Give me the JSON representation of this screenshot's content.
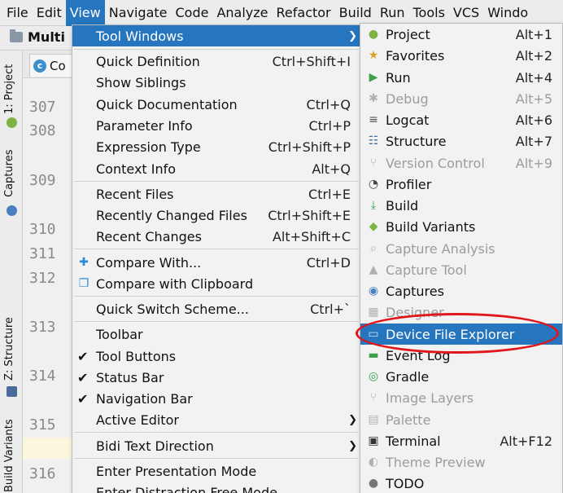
{
  "menubar": {
    "items": [
      "File",
      "Edit",
      "View",
      "Navigate",
      "Code",
      "Analyze",
      "Refactor",
      "Build",
      "Run",
      "Tools",
      "VCS",
      "Windo"
    ]
  },
  "ide": {
    "project_name": "Multi",
    "tab_label": "Co",
    "side_labels": [
      "1: Project",
      "Captures",
      "Z: Structure",
      "Build Variants"
    ],
    "line_numbers": [
      "307",
      "308",
      "309",
      "310",
      "311",
      "312",
      "313",
      "314",
      "315",
      "316"
    ]
  },
  "view_menu": {
    "items": [
      {
        "label": "Tool Windows",
        "shortcut": "",
        "submenu": true
      },
      {
        "label": "Quick Definition",
        "shortcut": "Ctrl+Shift+I"
      },
      {
        "label": "Show Siblings",
        "shortcut": ""
      },
      {
        "label": "Quick Documentation",
        "shortcut": "Ctrl+Q"
      },
      {
        "label": "Parameter Info",
        "shortcut": "Ctrl+P"
      },
      {
        "label": "Expression Type",
        "shortcut": "Ctrl+Shift+P"
      },
      {
        "label": "Context Info",
        "shortcut": "Alt+Q"
      },
      {
        "label": "Recent Files",
        "shortcut": "Ctrl+E"
      },
      {
        "label": "Recently Changed Files",
        "shortcut": "Ctrl+Shift+E"
      },
      {
        "label": "Recent Changes",
        "shortcut": "Alt+Shift+C"
      },
      {
        "label": "Compare With...",
        "shortcut": "Ctrl+D"
      },
      {
        "label": "Compare with Clipboard",
        "shortcut": ""
      },
      {
        "label": "Quick Switch Scheme...",
        "shortcut": "Ctrl+`"
      },
      {
        "label": "Toolbar",
        "shortcut": ""
      },
      {
        "label": "Tool Buttons",
        "shortcut": ""
      },
      {
        "label": "Status Bar",
        "shortcut": ""
      },
      {
        "label": "Navigation Bar",
        "shortcut": ""
      },
      {
        "label": "Active Editor",
        "shortcut": ""
      },
      {
        "label": "Bidi Text Direction",
        "shortcut": ""
      },
      {
        "label": "Enter Presentation Mode",
        "shortcut": ""
      },
      {
        "label": "Enter Distraction Free Mode",
        "shortcut": ""
      }
    ]
  },
  "tool_windows_menu": {
    "items": [
      {
        "label": "Project",
        "shortcut": "Alt+1",
        "icon": "android-project-icon"
      },
      {
        "label": "Favorites",
        "shortcut": "Alt+2",
        "icon": "star-icon"
      },
      {
        "label": "Run",
        "shortcut": "Alt+4",
        "icon": "play-icon"
      },
      {
        "label": "Debug",
        "shortcut": "Alt+5",
        "icon": "bug-icon"
      },
      {
        "label": "Logcat",
        "shortcut": "Alt+6",
        "icon": "logcat-icon"
      },
      {
        "label": "Structure",
        "shortcut": "Alt+7",
        "icon": "structure-icon"
      },
      {
        "label": "Version Control",
        "shortcut": "Alt+9",
        "icon": "vcs-icon"
      },
      {
        "label": "Profiler",
        "shortcut": "",
        "icon": "gauge-icon"
      },
      {
        "label": "Build",
        "shortcut": "",
        "icon": "build-icon"
      },
      {
        "label": "Build Variants",
        "shortcut": "",
        "icon": "android-icon"
      },
      {
        "label": "Capture Analysis",
        "shortcut": "",
        "icon": "magnifier-icon"
      },
      {
        "label": "Capture Tool",
        "shortcut": "",
        "icon": "capture-tool-icon"
      },
      {
        "label": "Captures",
        "shortcut": "",
        "icon": "camera-icon"
      },
      {
        "label": "Designer",
        "shortcut": "",
        "icon": "designer-icon"
      },
      {
        "label": "Device File Explorer",
        "shortcut": "",
        "icon": "device-file-icon"
      },
      {
        "label": "Event Log",
        "shortcut": "",
        "icon": "event-log-icon"
      },
      {
        "label": "Gradle",
        "shortcut": "",
        "icon": "gradle-icon"
      },
      {
        "label": "Image Layers",
        "shortcut": "",
        "icon": "image-layers-icon"
      },
      {
        "label": "Palette",
        "shortcut": "",
        "icon": "palette-icon"
      },
      {
        "label": "Terminal",
        "shortcut": "Alt+F12",
        "icon": "terminal-icon"
      },
      {
        "label": "Theme Preview",
        "shortcut": "",
        "icon": "theme-preview-icon"
      },
      {
        "label": "TODO",
        "shortcut": "",
        "icon": "todo-icon"
      }
    ]
  },
  "colors": {
    "highlight": "#2675bf",
    "annotation": "#e0161b"
  }
}
